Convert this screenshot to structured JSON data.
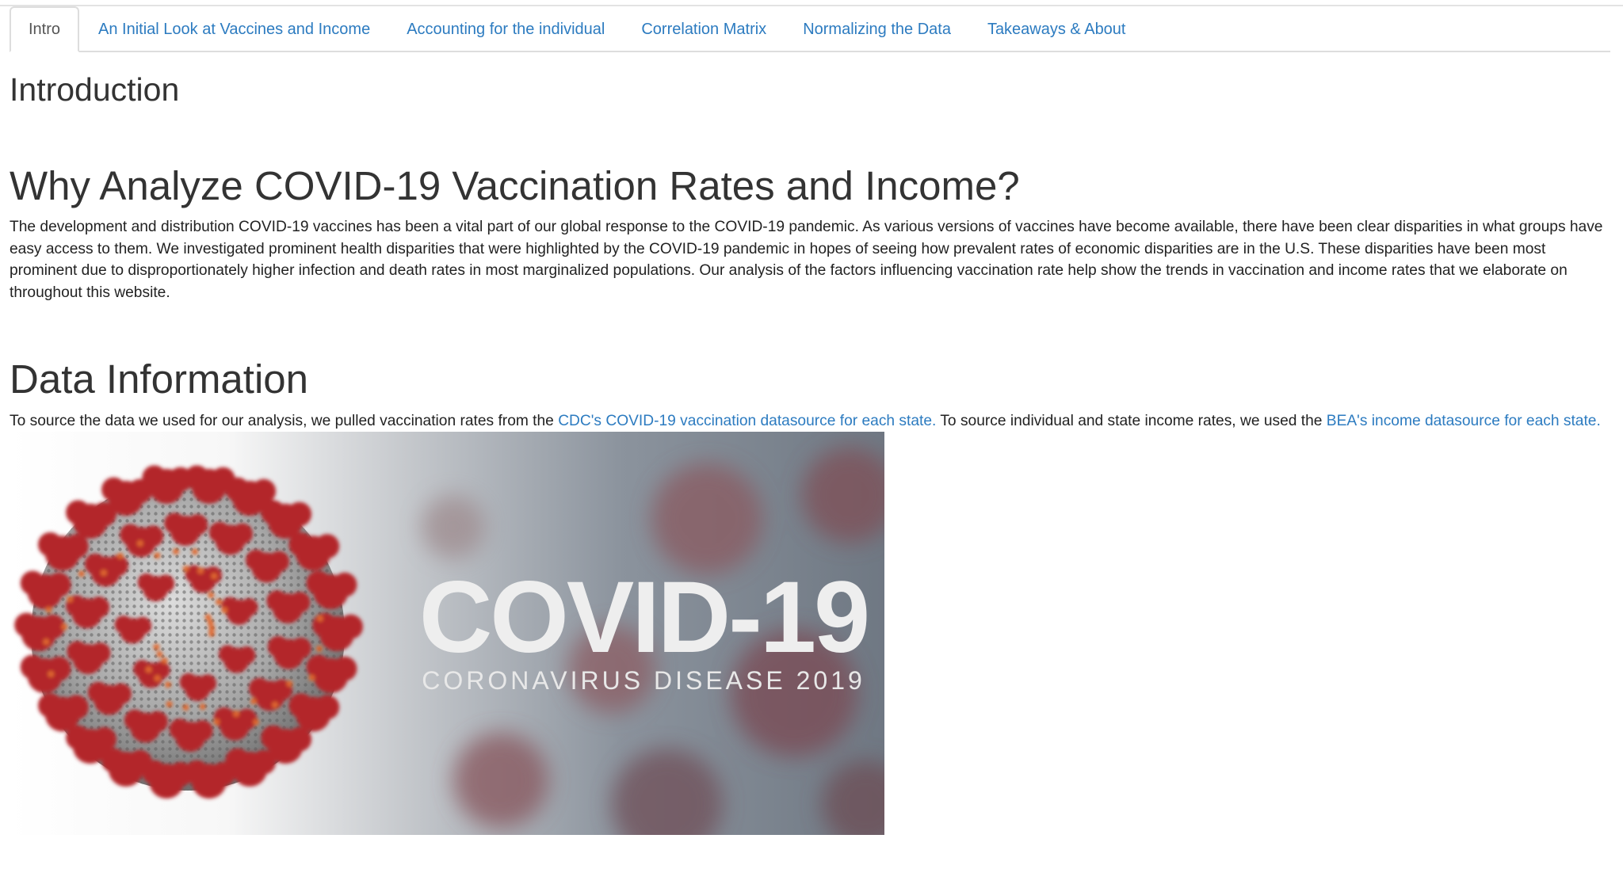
{
  "tabs": [
    {
      "label": "Intro",
      "active": true
    },
    {
      "label": "An Initial Look at Vaccines and Income",
      "active": false
    },
    {
      "label": "Accounting for the individual",
      "active": false
    },
    {
      "label": "Correlation Matrix",
      "active": false
    },
    {
      "label": "Normalizing the Data",
      "active": false
    },
    {
      "label": "Takeaways & About",
      "active": false
    }
  ],
  "intro": {
    "title": "Introduction",
    "why_heading": "Why Analyze COVID-19 Vaccination Rates and Income?",
    "paragraph": "The development and distribution COVID-19 vaccines has been a vital part of our global response to the COVID-19 pandemic. As various versions of vaccines have become available, there have been clear disparities in what groups have easy access to them. We investigated prominent health disparities that were highlighted by the COVID-19 pandemic in hopes of seeing how prevalent rates of economic disparities are in the U.S. These disparities have been most prominent due to disproportionately higher infection and death rates in most marginalized populations. Our analysis of the factors influencing vaccination rate help show the trends in vaccination and income rates that we elaborate on throughout this website."
  },
  "data_info": {
    "heading": "Data Information",
    "text_before": "To source the data we used for our analysis, we pulled vaccination rates from the ",
    "cdc_link": "CDC's COVID-19 vaccination datasource for each state.",
    "text_middle": " To source individual and state income rates, we used the ",
    "bea_link": "BEA's income datasource for each state."
  },
  "banner": {
    "title": "COVID-19",
    "subtitle": "CORONAVIRUS DISEASE 2019"
  },
  "colors": {
    "link": "#2c7bc0",
    "heading": "#333333",
    "virus_spike": "#b3262a",
    "virus_body": "#a9a9a9"
  }
}
